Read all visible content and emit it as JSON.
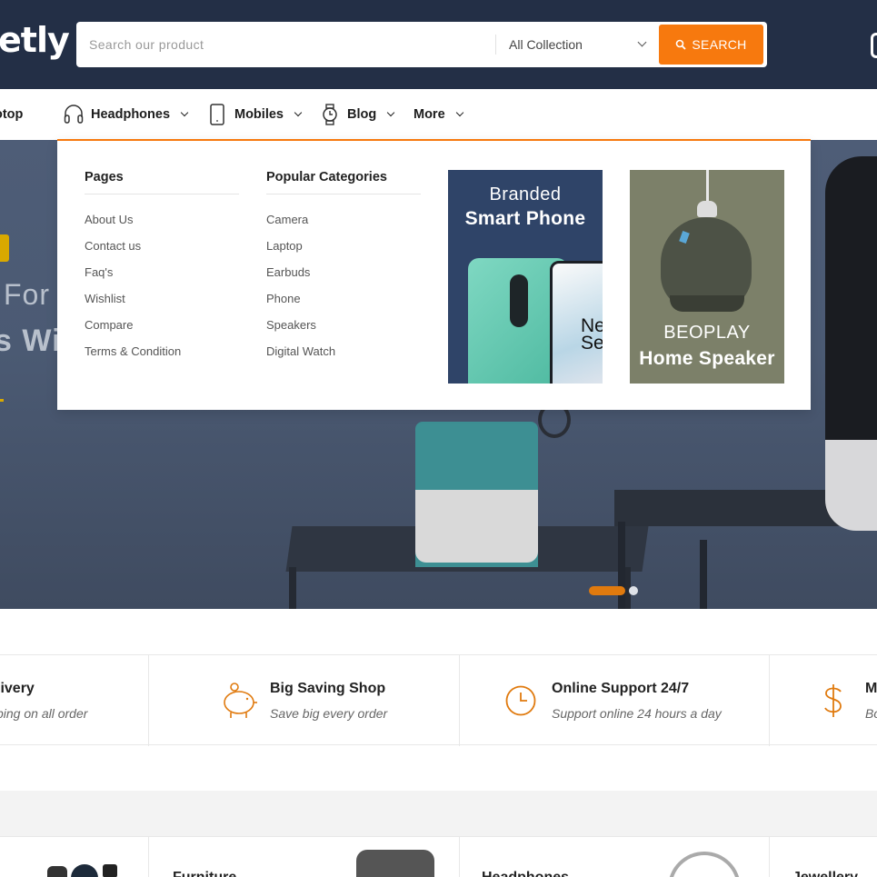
{
  "header": {
    "logo_text": "etly",
    "search": {
      "placeholder": "Search our product",
      "collection": "All Collection",
      "button_label": "SEARCH"
    }
  },
  "nav": {
    "items": [
      {
        "label": "otop"
      },
      {
        "label": "Headphones",
        "icon": "headphones-icon"
      },
      {
        "label": "Mobiles",
        "icon": "mobile-icon"
      },
      {
        "label": "Blog",
        "icon": "watch-icon"
      },
      {
        "label": "More"
      }
    ]
  },
  "mega_menu": {
    "pages": {
      "title": "Pages",
      "links": [
        "About Us",
        "Contact us",
        "Faq's",
        "Wishlist",
        "Compare",
        "Terms & Condition"
      ]
    },
    "categories": {
      "title": "Popular Categories",
      "links": [
        "Camera",
        "Laptop",
        "Earbuds",
        "Phone",
        "Speakers",
        "Digital Watch"
      ]
    },
    "promo1": {
      "line1": "Branded",
      "line2": "Smart Phone",
      "phone_text": "Ne\nSe"
    },
    "promo2": {
      "line1": "BEOPLAY",
      "line2": "Home Speaker"
    }
  },
  "hero": {
    "text1": "For",
    "text2": "s Wi",
    "slides_total": 2,
    "slide_active": 1
  },
  "features": [
    {
      "title": "livery",
      "subtitle": "ping on all order",
      "icon": "truck-icon"
    },
    {
      "title": "Big Saving Shop",
      "subtitle": "Save big every order",
      "icon": "piggy-bank-icon"
    },
    {
      "title": "Online Support 24/7",
      "subtitle": "Support online 24 hours a day",
      "icon": "clock-icon"
    },
    {
      "title": "M",
      "subtitle": "Bo",
      "icon": "dollar-icon"
    }
  ],
  "categories": [
    {
      "label": ""
    },
    {
      "label": "Furniture"
    },
    {
      "label": "Headphones"
    },
    {
      "label": "Jewellery"
    }
  ],
  "colors": {
    "header_bg": "#232f46",
    "accent": "#f7790e",
    "hero_bg": "#4b5a73"
  }
}
